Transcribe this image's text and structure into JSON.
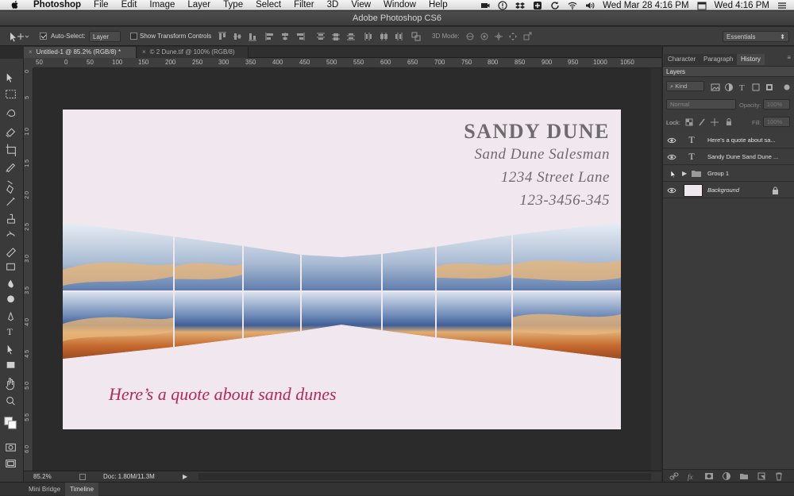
{
  "menubar": {
    "app": "Photoshop",
    "items": [
      "File",
      "Edit",
      "Image",
      "Layer",
      "Type",
      "Select",
      "Filter",
      "3D",
      "View",
      "Window",
      "Help"
    ],
    "date1": "Wed Mar 28  4:16 PM",
    "date2": "Wed  4:16 PM"
  },
  "window_title": "Adobe Photoshop CS6",
  "options": {
    "auto_select_label": "Auto-Select:",
    "auto_select_value": "Layer",
    "show_transform_label": "Show Transform Controls",
    "mode_3d_label": "3D Mode:",
    "workspace": "Essentials"
  },
  "tabs": [
    {
      "label": "Untitled-1 @ 85.2% (RGB/8) *"
    },
    {
      "label": "© 2 Dune.tif @ 100% (RGB/8)"
    }
  ],
  "ruler_h": [
    "50",
    "0",
    "50",
    "100",
    "150",
    "200",
    "250",
    "300",
    "350",
    "400",
    "450",
    "500",
    "550",
    "600",
    "650",
    "700",
    "750",
    "800",
    "850",
    "900",
    "950",
    "1000",
    "1050"
  ],
  "ruler_v": [
    "0",
    "5",
    "1 0",
    "1 5",
    "2 0",
    "2 5",
    "3 0",
    "3 5",
    "4 0",
    "4 5",
    "5 0",
    "5 5",
    "6 0"
  ],
  "card": {
    "name": "SANDY DUNE",
    "title": "Sand Dune Salesman",
    "address": "1234 Street Lane",
    "phone": "123-3456-345",
    "quote": "Here’s a quote about sand dunes",
    "bg_color": "#f1e8ef",
    "quote_color": "#b4285a"
  },
  "status": {
    "zoom": "85.2%",
    "doc": "Doc: 1.80M/11.3M"
  },
  "bottom_tabs": [
    "Mini Bridge",
    "Timeline"
  ],
  "panel": {
    "tabs": [
      "Character",
      "Paragraph",
      "History"
    ],
    "layers_title": "Layers",
    "kind": "Kind",
    "blend": "Normal",
    "opacity_label": "Opacity:",
    "opacity_value": "100%",
    "lock_label": "Lock:",
    "fill_label": "Fill:",
    "fill_value": "100%",
    "layers": [
      {
        "name": "Here's a quote about sa...",
        "type": "text",
        "visible": true
      },
      {
        "name": "Sandy Dune Sand Dune ...",
        "type": "text",
        "visible": true
      },
      {
        "name": "Group 1",
        "type": "group",
        "visible": false
      },
      {
        "name": "Background",
        "type": "background",
        "visible": true
      }
    ]
  }
}
